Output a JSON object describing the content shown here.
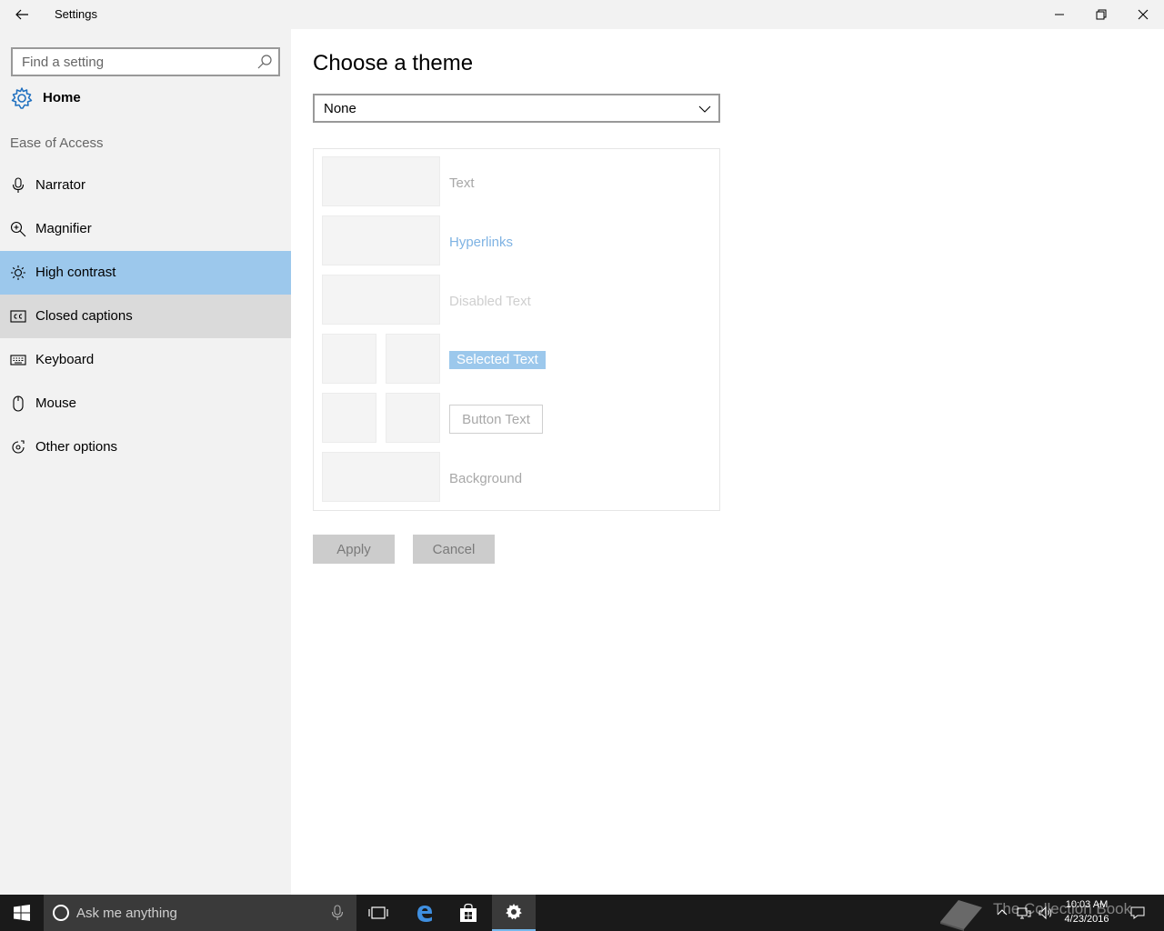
{
  "window": {
    "title": "Settings"
  },
  "sidebar": {
    "search_placeholder": "Find a setting",
    "home_label": "Home",
    "section_label": "Ease of Access",
    "items": [
      {
        "label": "Narrator",
        "icon": "microphone-icon"
      },
      {
        "label": "Magnifier",
        "icon": "magnifier-icon"
      },
      {
        "label": "High contrast",
        "icon": "sun-icon",
        "state": "selected"
      },
      {
        "label": "Closed captions",
        "icon": "closed-captions-icon",
        "state": "hover"
      },
      {
        "label": "Keyboard",
        "icon": "keyboard-icon"
      },
      {
        "label": "Mouse",
        "icon": "mouse-icon"
      },
      {
        "label": "Other options",
        "icon": "other-options-icon"
      }
    ]
  },
  "main": {
    "title": "Choose a theme",
    "theme_select": {
      "selected": "None"
    },
    "preview": {
      "text": "Text",
      "hyperlinks": "Hyperlinks",
      "disabled_text": "Disabled Text",
      "selected_text": "Selected Text",
      "button_text": "Button Text",
      "background": "Background"
    },
    "apply_label": "Apply",
    "cancel_label": "Cancel"
  },
  "taskbar": {
    "search_placeholder": "Ask me anything",
    "time": "10:03 AM",
    "date": "4/23/2016",
    "watermark": "The Collection Book"
  },
  "colors": {
    "selected_nav": "#9cc8ec",
    "hover_nav": "#dadada",
    "hyperlink": "#7fb3e3",
    "selected_text_bg": "#9cc8ec",
    "accent": "#76b9ed"
  }
}
